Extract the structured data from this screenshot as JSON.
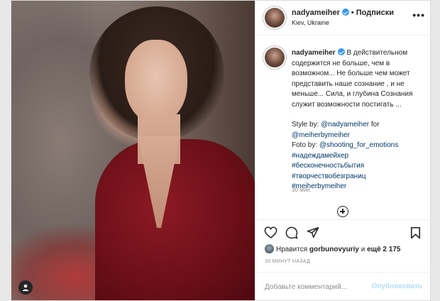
{
  "header": {
    "username": "nadyameiher",
    "follow_label": "Подписки",
    "location": "Kiev, Ukraine",
    "more_label": "•••"
  },
  "caption": {
    "username": "nadyameiher",
    "text": "В действительном содержится не больше, чем в возможном... Не больше чем может представить наше сознание , и не меньше... Сила, и глубина Сознания служит возможности постигать ...",
    "style_prefix": "Style by: ",
    "style_tag": "@nadyameiher",
    "style_for": " for",
    "style_tag2": "@meiherbymeiher",
    "foto_prefix": "Foto by: ",
    "foto_tag": "@shooting_for_emotions",
    "hashtags": [
      "#надеждамейхер",
      "#бесконечностьбытия",
      "#творчествобезграниц",
      "#meiherbymeiher"
    ],
    "time_ago": "30 мин."
  },
  "likes": {
    "prefix": "Нравится ",
    "user": "gorbunovyuriy",
    "middle": " и ",
    "count": "ещё 2 175"
  },
  "post_date": "30 МИНУТ НАЗАД",
  "comment": {
    "placeholder": "Добавьте комментарий...",
    "publish_label": "Опубликовать"
  },
  "colors": {
    "link": "#00376b",
    "verified": "#3897f0",
    "muted": "#8e8e8e",
    "publish_disabled": "#b2dffc"
  }
}
